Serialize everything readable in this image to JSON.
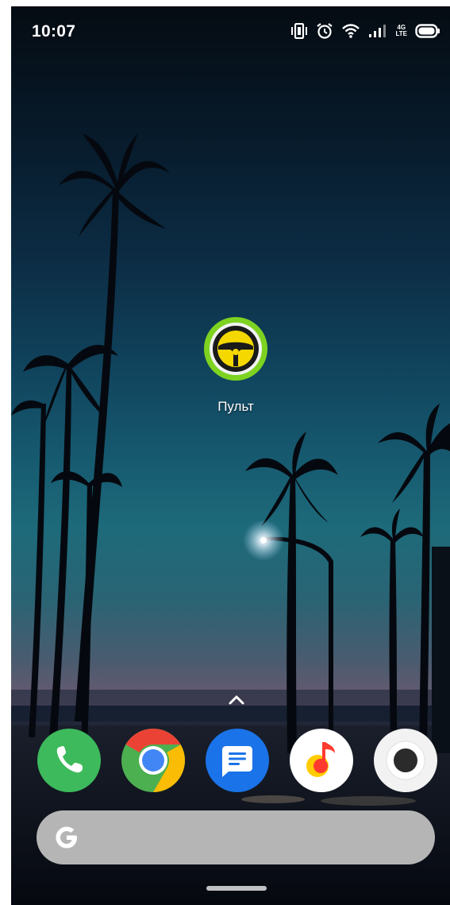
{
  "status_bar": {
    "time": "10:07",
    "network_type_top": "4G",
    "network_type_bottom": "LTE",
    "icons": [
      "vibrate-icon",
      "alarm-icon",
      "wifi-icon",
      "signal-icon",
      "network-type-icon",
      "battery-icon"
    ]
  },
  "home": {
    "app": {
      "label": "Пульт",
      "icon": "steering-wheel-icon",
      "colors": {
        "ring": "#7ed321",
        "face": "#f5d800",
        "wheel": "#1a1a1a"
      }
    },
    "drawer_handle_icon": "chevron-up-icon"
  },
  "dock": {
    "apps": [
      {
        "name": "phone-app",
        "icon": "phone-icon",
        "color": "#3dba5c"
      },
      {
        "name": "chrome-app",
        "icon": "chrome-icon",
        "color": "#4285f4"
      },
      {
        "name": "messages-app",
        "icon": "messages-icon",
        "color": "#1a73e8"
      },
      {
        "name": "music-app",
        "icon": "music-note-icon",
        "color": "#ff3b30"
      },
      {
        "name": "record-app",
        "icon": "record-icon",
        "color": "#f2f2f2"
      }
    ]
  },
  "search": {
    "icon": "google-g-icon"
  }
}
